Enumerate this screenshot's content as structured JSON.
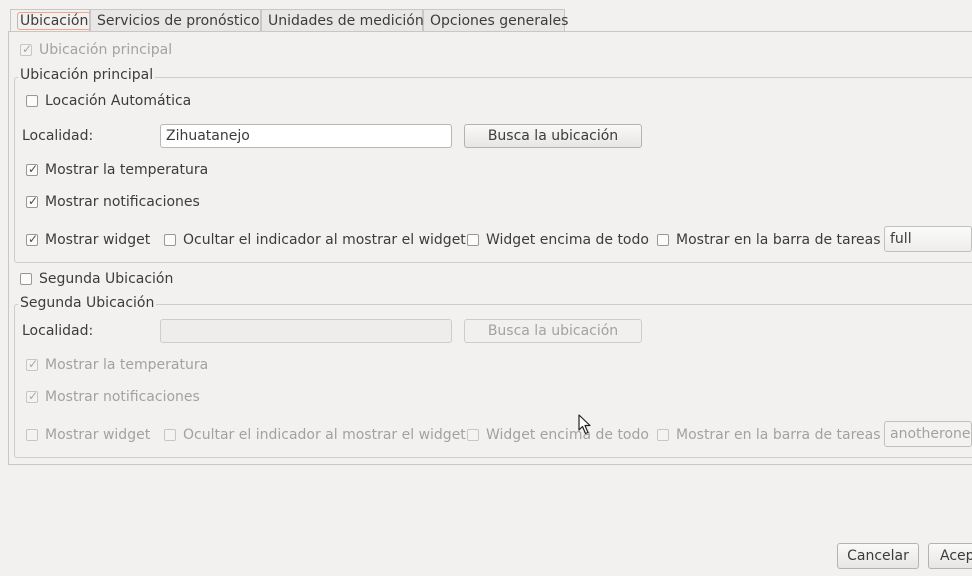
{
  "tabs": [
    {
      "label": "Ubicación"
    },
    {
      "label": "Servicios de pronóstico"
    },
    {
      "label": "Unidades de medición"
    },
    {
      "label": "Opciones generales"
    }
  ],
  "main_toggle": {
    "label": "Ubicación principal",
    "checked": true
  },
  "primary": {
    "frame_title": "Ubicación principal",
    "auto_location_label": "Locación Automática",
    "locality_label": "Localidad:",
    "locality_value": "Zihuatanejo",
    "search_button": "Busca la ubicación",
    "show_temperature": "Mostrar la temperatura",
    "show_notifications": "Mostrar notificaciones",
    "show_widget": "Mostrar widget",
    "hide_indicator": "Ocultar el indicador al mostrar el widget",
    "widget_on_top": "Widget encima de todo",
    "show_in_taskbar": "Mostrar en la barra de tareas",
    "widget_style": "full"
  },
  "second_toggle": {
    "label": "Segunda Ubicación",
    "checked": false
  },
  "secondary": {
    "frame_title": "Segunda Ubicación",
    "locality_label": "Localidad:",
    "locality_value": "",
    "search_button": "Busca la ubicación",
    "show_temperature": "Mostrar la temperatura",
    "show_notifications": "Mostrar notificaciones",
    "show_widget": "Mostrar widget",
    "hide_indicator": "Ocultar el indicador al mostrar el widget",
    "widget_on_top": "Widget encima de todo",
    "show_in_taskbar": "Mostrar en la barra de tareas",
    "widget_style": "anotherone"
  },
  "footer": {
    "cancel": "Cancelar",
    "accept": "Acep"
  },
  "check_mark": "✓"
}
